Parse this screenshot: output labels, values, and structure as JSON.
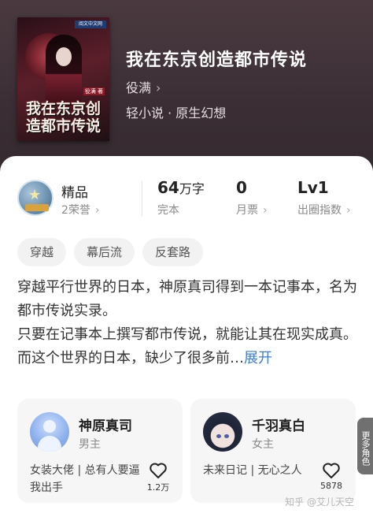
{
  "book": {
    "title": "我在东京创造都市传说",
    "author": "役满",
    "genre": "轻小说 · 原生幻想",
    "cover_title": "我在东京创造都市传说",
    "cover_brand": "阅文中文网",
    "cover_author": "役满 著"
  },
  "stats": {
    "quality_label": "精品",
    "honors": "2荣誉",
    "word_count_value": "64",
    "word_count_unit": "万字",
    "status": "完本",
    "monthly_tickets_value": "0",
    "monthly_tickets_label": "月票",
    "influence_value": "Lv1",
    "influence_label": "出圈指数"
  },
  "tags": [
    "穿越",
    "幕后流",
    "反套路"
  ],
  "description": {
    "line1": "穿越平行世界的日本，神原真司得到一本记事本，名为都市传说实录。",
    "line2": "只要在记事本上撰写都市传说，就能让其在现实成真。而这个世界的日本，缺少了很多前…",
    "expand": "展开"
  },
  "roles": [
    {
      "name": "神原真司",
      "type": "男主",
      "desc": "女装大佬 | 总有人要逼我出手",
      "likes": "1.2万",
      "avatar": "default-avatar"
    },
    {
      "name": "千羽真白",
      "type": "女主",
      "desc": "未来日记 | 无心之人",
      "likes": "5878",
      "avatar": "anime-girl-avatar"
    }
  ],
  "more_tab": "更多角色",
  "watermark": "知乎 @艾儿天空",
  "colors": {
    "accent": "#3b7ed3",
    "header_bg": "#3b2f35"
  }
}
